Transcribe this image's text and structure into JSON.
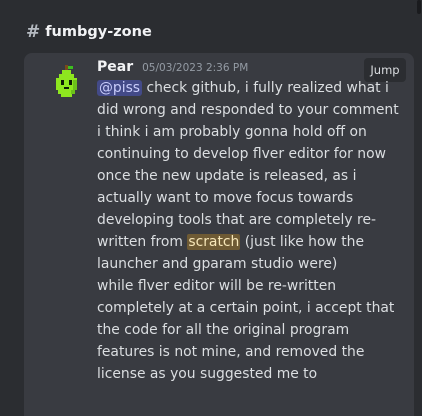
{
  "channel": {
    "hash": "#",
    "name": "fumbgy-zone"
  },
  "message": {
    "username": "Pear",
    "timestamp": "05/03/2023 2:36 PM",
    "jump_label": "Jump",
    "mention": "@piss",
    "line1_rest": " check github, i fully realized what i",
    "lines_a": [
      "did wrong and responded to your comment",
      "i think i am probably gonna hold off on",
      "continuing to develop flver editor for now",
      "once the new update is released, as i",
      "actually want to move focus towards",
      "developing tools that are completely re-"
    ],
    "line8_pre": "written from ",
    "highlight": "scratch",
    "line8_post": " (just like how the",
    "lines_b": [
      "launcher and gparam studio were)",
      "while flver editor will be re-written",
      "completely at a certain point, i accept that",
      "the code for all the original program",
      "features is not mine, and removed the",
      "license as you suggested me to"
    ],
    "avatar_icon": "green-pear-avatar",
    "colors": {
      "mention_bg": "#434a88",
      "highlight_bg": "#6e5a34",
      "card_bg": "#393b41",
      "page_bg": "#2b2d31"
    }
  }
}
